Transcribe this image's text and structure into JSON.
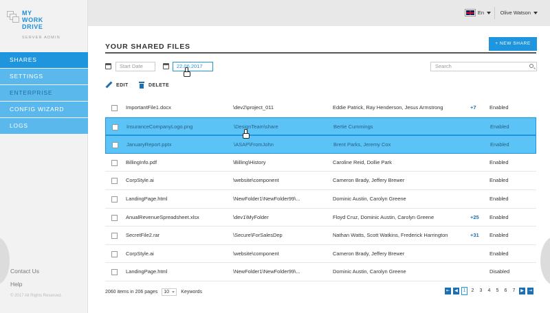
{
  "brand": {
    "line1": "MY",
    "line2": "WORK",
    "line3": "DRIVE",
    "sub": "SERVER ADMIN"
  },
  "sidebar": {
    "items": [
      {
        "label": "SHARES",
        "state": "active"
      },
      {
        "label": "SETTINGS",
        "state": "normal"
      },
      {
        "label": "ENTERPRISE",
        "state": "normal"
      },
      {
        "label": "CONFIG WIZARD",
        "state": "normal"
      },
      {
        "label": "LOGS",
        "state": "normal"
      }
    ],
    "footer": {
      "contact": "Contact Us",
      "help": "Help",
      "copyright": "© 2017 All Rights Reserved."
    }
  },
  "topbar": {
    "language": "En",
    "user": "Olive Watson",
    "flag_icon": "uk-flag-icon"
  },
  "page": {
    "title": "YOUR SHARED FILES",
    "new_share": "+ NEW SHARE"
  },
  "filters": {
    "start_date_placeholder": "Start Date",
    "end_date_value": "22.06.2017",
    "search_placeholder": "Search"
  },
  "actions": {
    "edit": "EDIT",
    "delete": "DELETE"
  },
  "files": [
    {
      "name": "ImportantFile1.docx",
      "path": "\\dev2\\project_011",
      "users": "Eddie Patrick, Ray Henderson, Jesus Armstrong",
      "more": "+7",
      "status": "Enabled",
      "checked": false,
      "selected": false
    },
    {
      "name": "InsuranceCompanyLogo.png",
      "path": "\\DesignTeam\\share",
      "users": "Bertie Cummings",
      "more": "",
      "status": "Enabled",
      "checked": true,
      "selected": true
    },
    {
      "name": "JanuaryReport.pptx",
      "path": "\\ASAP\\FromJohn",
      "users": "Brent Parks, Jeremy Cox",
      "more": "",
      "status": "Enabled",
      "checked": false,
      "selected": true
    },
    {
      "name": "BillingInfo.pdf",
      "path": "\\Billing\\History",
      "users": "Caroline Reid, Dollie Park",
      "more": "",
      "status": "Enabled",
      "checked": false,
      "selected": false
    },
    {
      "name": "CorpStyle.ai",
      "path": "\\website\\component",
      "users": "Cameron Brady, Jeffery Brewer",
      "more": "",
      "status": "Enabled",
      "checked": false,
      "selected": false
    },
    {
      "name": "LandingPage.html",
      "path": "\\NewFolder1\\NewFolder99\\...",
      "users": "Dominic Austin, Carolyn Greene",
      "more": "",
      "status": "Enabled",
      "checked": false,
      "selected": false
    },
    {
      "name": "AnualRevenueSpreadsheet.xlsx",
      "path": "\\dev1\\MyFolder",
      "users": "Floyd Cruz, Dominic Austin, Carolyn Greene",
      "more": "+25",
      "status": "Enabled",
      "checked": false,
      "selected": false
    },
    {
      "name": "SecretFile2.rar",
      "path": "\\Secure\\ForSalesDep",
      "users": "Nathan Watts, Scott Watkins, Frederick Harrington",
      "more": "+31",
      "status": "Enabled",
      "checked": false,
      "selected": false
    },
    {
      "name": "CorpStyle.ai",
      "path": "\\website\\component",
      "users": "Cameron Brady, Jeffery Brewer",
      "more": "",
      "status": "Enabled",
      "checked": false,
      "selected": false
    },
    {
      "name": "LandingPage.html",
      "path": "\\NewFolder1\\NewFolder99\\...",
      "users": "Dominic Austin, Carolyn Greene",
      "more": "",
      "status": "Disabled",
      "checked": false,
      "selected": false
    }
  ],
  "pagination": {
    "summary": "2060 items in 206 pages",
    "page_size": "10",
    "keywords": "Keywords",
    "pages": [
      "1",
      "2",
      "3",
      "4",
      "5",
      "6",
      "7"
    ],
    "current": "1"
  },
  "colors": {
    "accent": "#1f95de",
    "selected_row": "#5bc3f5",
    "sidebar_bg": "#f2f2f2"
  }
}
